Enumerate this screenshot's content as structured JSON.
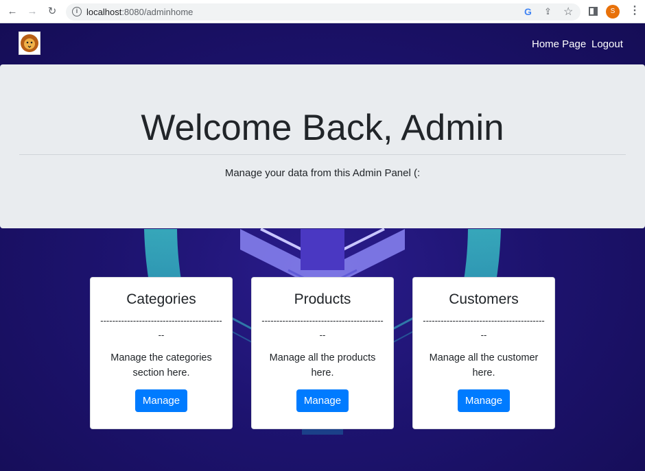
{
  "browser": {
    "url_host": "localhost",
    "url_path": ":8080/adminhome",
    "profile_initial": "S",
    "back_icon": "←",
    "forward_icon": "→",
    "reload_icon": "↻",
    "info_icon": "i",
    "google_icon": "G",
    "share_icon": "⇪",
    "star_icon": "☆",
    "menu_icon": "⋮"
  },
  "navbar": {
    "home_label": "Home Page",
    "logout_label": "Logout"
  },
  "jumbotron": {
    "title": "Welcome Back, Admin",
    "subtitle": "Manage your data from this Admin Panel (:"
  },
  "cards": [
    {
      "title": "Categories",
      "divider": "-------------------------------------------",
      "description": "Manage the categories section here.",
      "button": "Manage"
    },
    {
      "title": "Products",
      "divider": "-------------------------------------------",
      "description": "Manage all the products here.",
      "button": "Manage"
    },
    {
      "title": "Customers",
      "divider": "-------------------------------------------",
      "description": "Manage all the customer here.",
      "button": "Manage"
    }
  ],
  "colors": {
    "navbar_bg": "#1c1268",
    "jumbotron_bg": "#e9ecef",
    "button_primary": "#007bff"
  }
}
